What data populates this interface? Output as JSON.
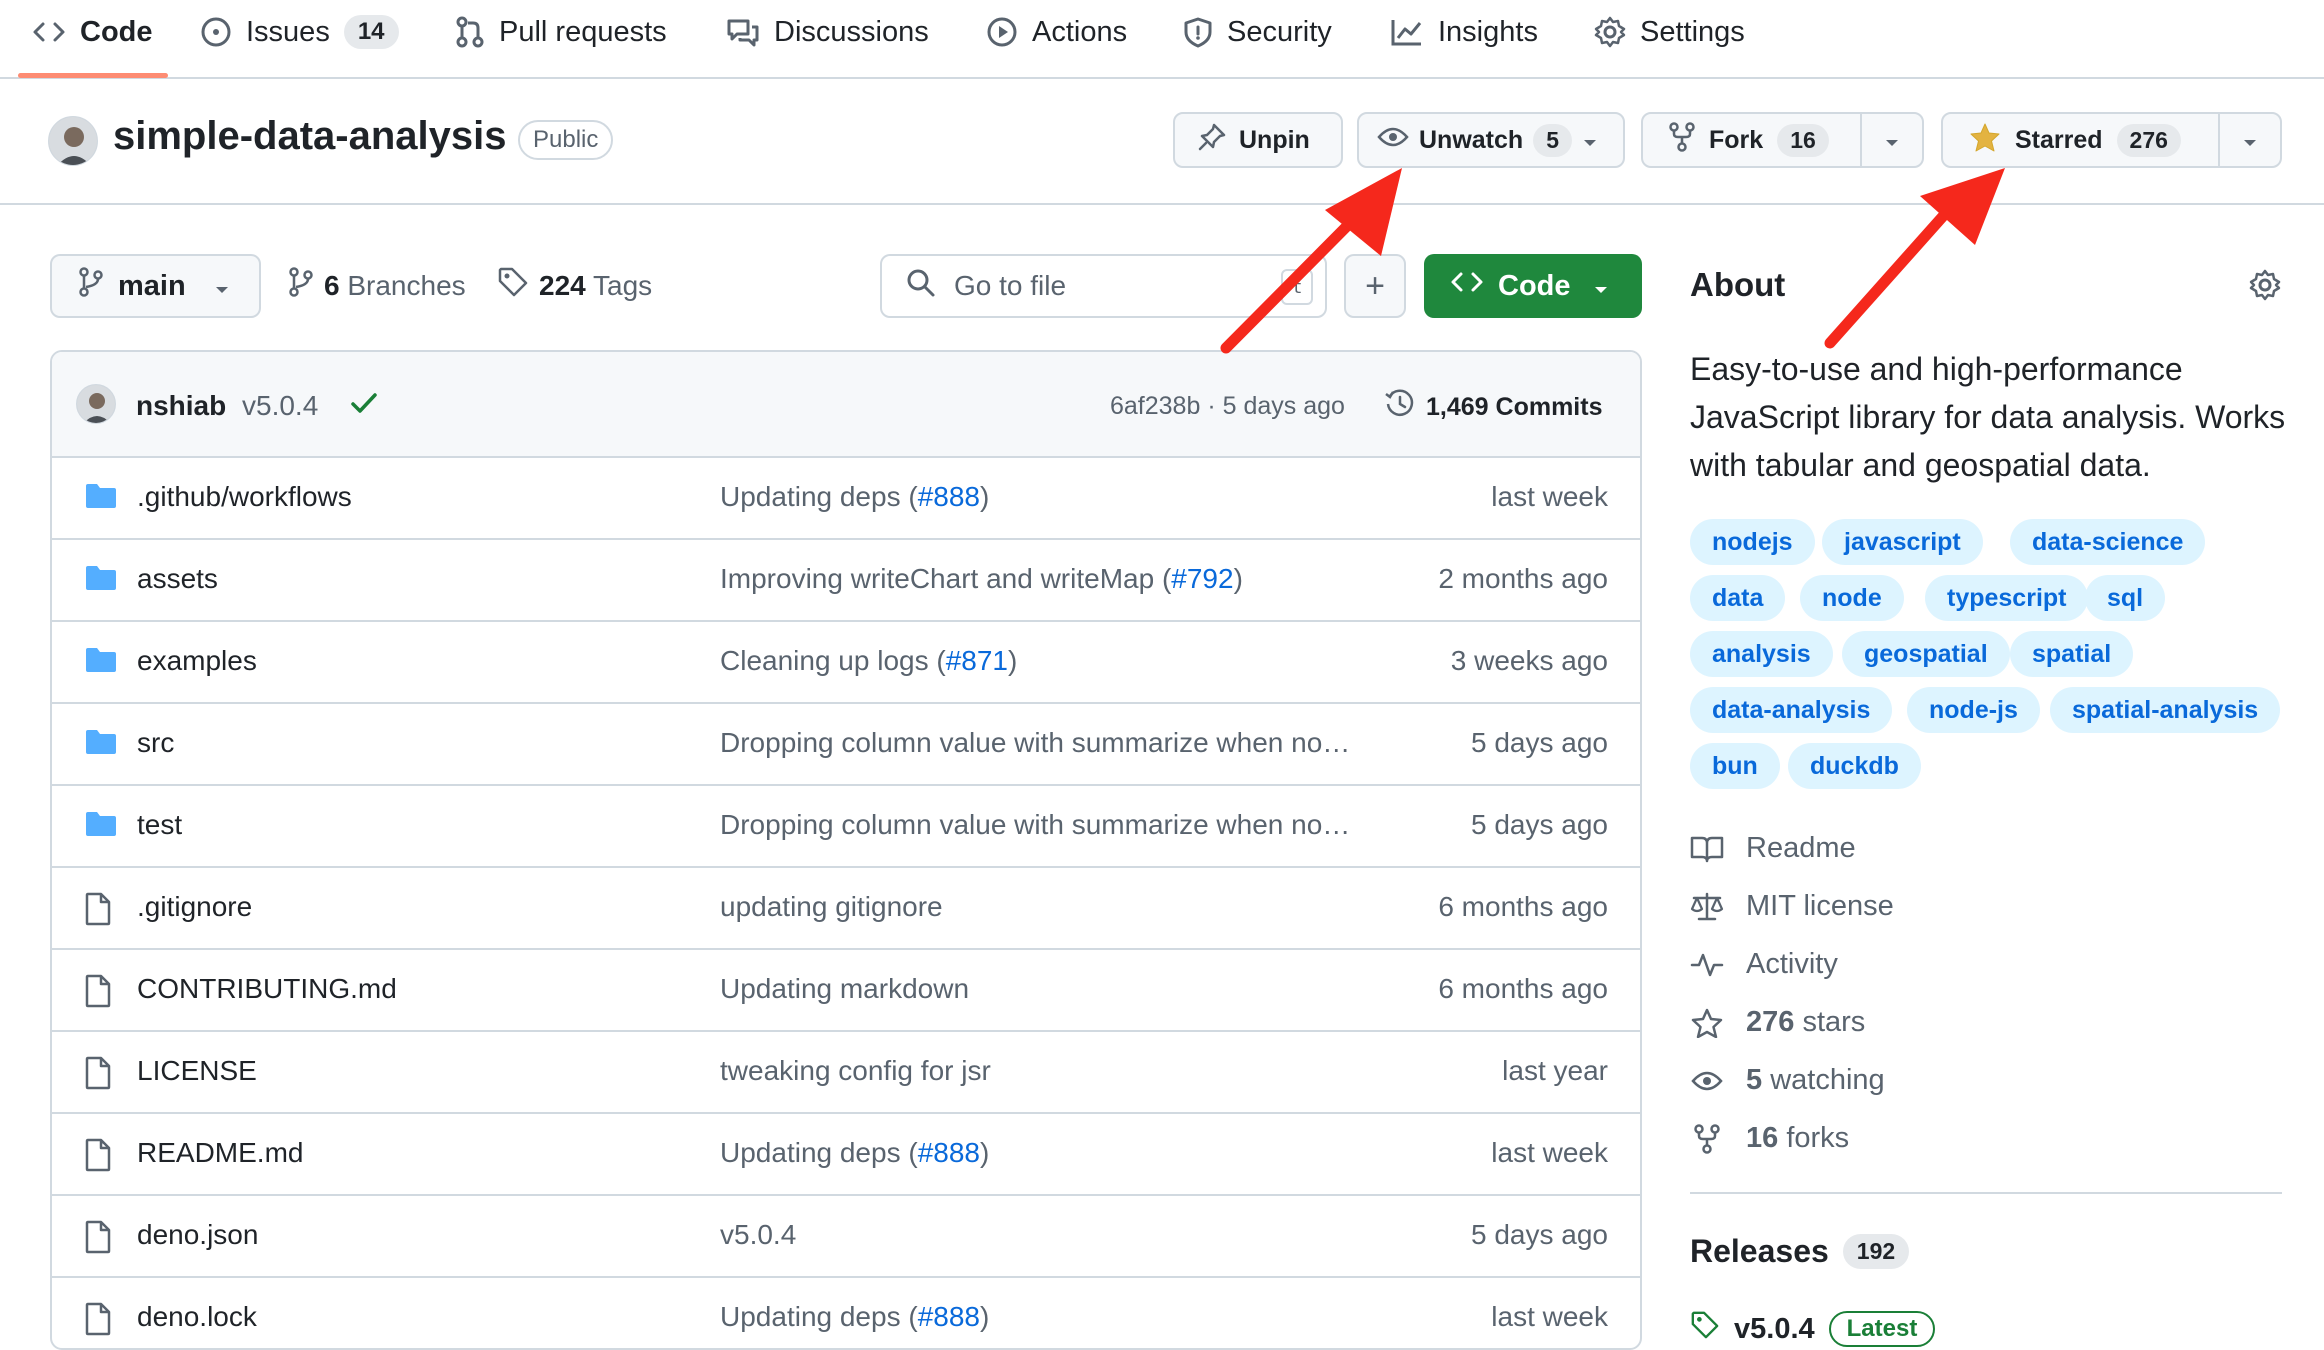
{
  "tabs": [
    {
      "label": "Code",
      "icon": "code-icon"
    },
    {
      "label": "Issues",
      "icon": "issue-icon",
      "count": "14"
    },
    {
      "label": "Pull requests",
      "icon": "pull-request-icon"
    },
    {
      "label": "Discussions",
      "icon": "discussion-icon"
    },
    {
      "label": "Actions",
      "icon": "play-icon"
    },
    {
      "label": "Security",
      "icon": "shield-icon"
    },
    {
      "label": "Insights",
      "icon": "graph-icon"
    },
    {
      "label": "Settings",
      "icon": "gear-icon"
    }
  ],
  "repo": {
    "name": "simple-data-analysis",
    "visibility": "Public",
    "unpin_label": "Unpin",
    "watch_label": "Unwatch",
    "watch_count": "5",
    "fork_label": "Fork",
    "fork_count": "16",
    "star_label": "Starred",
    "star_count": "276"
  },
  "toolbar": {
    "branch": "main",
    "branches_count": "6",
    "branches_label": "Branches",
    "tags_count": "224",
    "tags_label": "Tags",
    "goto_placeholder": "Go to file",
    "goto_kbd": "t",
    "add_label": "+",
    "code_label": "Code"
  },
  "commit": {
    "author": "nshiab",
    "message": "v5.0.4",
    "hash": "6af238b",
    "time": "5 days ago",
    "commits_count": "1,469",
    "commits_label": "Commits"
  },
  "files": [
    {
      "name": ".github/workflows",
      "type": "folder",
      "msg": "Updating deps (",
      "pr": "#888",
      "msg_end": ")",
      "time": "last week"
    },
    {
      "name": "assets",
      "type": "folder",
      "msg": "Improving writeChart and writeMap (",
      "pr": "#792",
      "msg_end": ")",
      "time": "2 months ago"
    },
    {
      "name": "examples",
      "type": "folder",
      "msg": "Cleaning up logs (",
      "pr": "#871",
      "msg_end": ")",
      "time": "3 weeks ago"
    },
    {
      "name": "src",
      "type": "folder",
      "msg": "Dropping column value with summarize when no…",
      "pr": "",
      "msg_end": "",
      "time": "5 days ago"
    },
    {
      "name": "test",
      "type": "folder",
      "msg": "Dropping column value with summarize when no…",
      "pr": "",
      "msg_end": "",
      "time": "5 days ago"
    },
    {
      "name": ".gitignore",
      "type": "file",
      "msg": "updating gitignore",
      "pr": "",
      "msg_end": "",
      "time": "6 months ago"
    },
    {
      "name": "CONTRIBUTING.md",
      "type": "file",
      "msg": "Updating markdown",
      "pr": "",
      "msg_end": "",
      "time": "6 months ago"
    },
    {
      "name": "LICENSE",
      "type": "file",
      "msg": "tweaking config for jsr",
      "pr": "",
      "msg_end": "",
      "time": "last year"
    },
    {
      "name": "README.md",
      "type": "file",
      "msg": "Updating deps (",
      "pr": "#888",
      "msg_end": ")",
      "time": "last week"
    },
    {
      "name": "deno.json",
      "type": "file",
      "msg": "v5.0.4",
      "pr": "",
      "msg_end": "",
      "time": "5 days ago"
    },
    {
      "name": "deno.lock",
      "type": "file",
      "msg": "Updating deps (",
      "pr": "#888",
      "msg_end": ")",
      "time": "last week"
    }
  ],
  "about": {
    "title": "About",
    "description": "Easy-to-use and high-performance JavaScript library for data analysis. Works with tabular and geospatial data.",
    "topics": [
      "nodejs",
      "javascript",
      "data-science",
      "data",
      "node",
      "typescript",
      "sql",
      "analysis",
      "geospatial",
      "spatial",
      "data-analysis",
      "node-js",
      "spatial-analysis",
      "bun",
      "duckdb"
    ],
    "links": [
      {
        "icon": "book-icon",
        "pre": "",
        "bold": "",
        "text": "Readme"
      },
      {
        "icon": "law-icon",
        "pre": "",
        "bold": "",
        "text": "MIT license"
      },
      {
        "icon": "pulse-icon",
        "pre": "",
        "bold": "",
        "text": "Activity"
      },
      {
        "icon": "star-icon",
        "pre": "",
        "bold": "276",
        "text": " stars"
      },
      {
        "icon": "eye-icon",
        "pre": "",
        "bold": "5",
        "text": " watching"
      },
      {
        "icon": "fork-icon",
        "pre": "",
        "bold": "16",
        "text": " forks"
      }
    ],
    "releases_label": "Releases",
    "releases_count": "192",
    "latest_tag": "v5.0.4",
    "latest_label": "Latest"
  },
  "colors": {
    "accent_green": "#1f883d",
    "link_blue": "#0969da",
    "topic_bg": "#ddf4ff",
    "tab_underline": "#fd8c73",
    "annotation_arrow": "#f5281c",
    "star_yellow": "#e3b341",
    "folder_blue": "#54aeff"
  }
}
